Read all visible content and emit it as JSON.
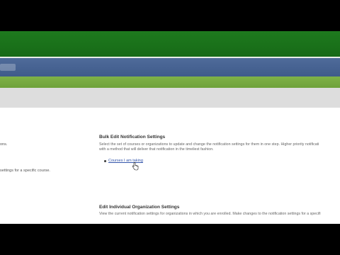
{
  "colors": {
    "banner": "#1e7a1e",
    "nav": "#4f6b9a",
    "subnav": "#7fb247",
    "toolbar": "#dddddd",
    "link": "#3355aa"
  },
  "left_fragments": {
    "line1": "ons.",
    "line2": "settings for a specific course."
  },
  "bulk": {
    "title": "Bulk Edit Notification Settings",
    "desc_line1": "Select the set of courses or organizations to update and change the notification settings for them in one step. Higher priority notificati",
    "desc_line2": "with a method that will deliver that notification in the timeliest fashion.",
    "links": [
      "Courses I am taking"
    ]
  },
  "individual_org": {
    "title": "Edit Individual Organization Settings",
    "desc": "View the current notification settings for organizations in which you are enrolled. Make changes to the notification settings for a specifi"
  },
  "cursor_icon": "hand-pointer-icon"
}
